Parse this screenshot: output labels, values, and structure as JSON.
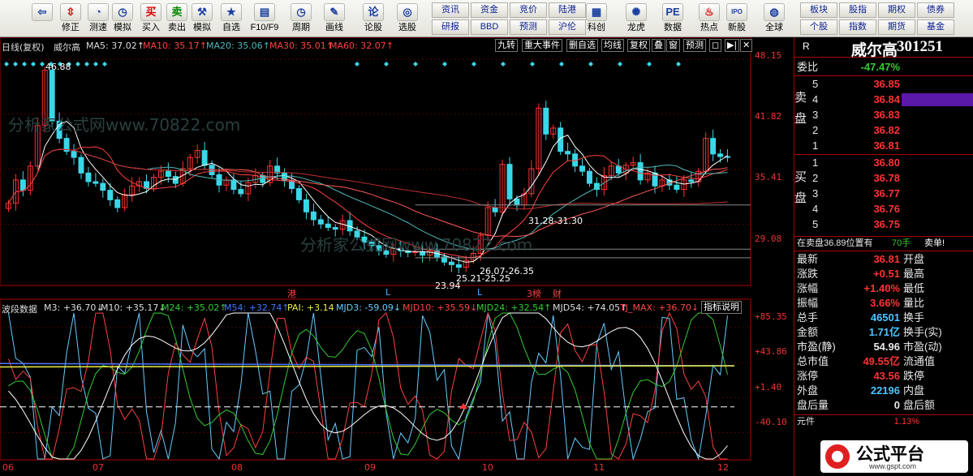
{
  "toolbar": {
    "buttons": [
      {
        "label": "",
        "icon": "back-arrow-icon",
        "glyph": "⇦"
      },
      {
        "label": "修正",
        "icon": "up-down-arrows-icon",
        "glyph": "⇳"
      },
      {
        "label": "测速",
        "icon": "speed-check-icon",
        "glyph": "◔"
      },
      {
        "label": "模拟",
        "icon": "clock-icon",
        "glyph": "◷"
      },
      {
        "label": "买入",
        "icon": "buy-icon",
        "glyph": "买"
      },
      {
        "label": "卖出",
        "icon": "sell-icon",
        "glyph": "卖"
      },
      {
        "label": "模拟",
        "icon": "hammer-icon",
        "glyph": "⚒"
      },
      {
        "label": "自选",
        "icon": "star-icon",
        "glyph": "★"
      },
      {
        "label": "F10/F9",
        "icon": "document-icon",
        "glyph": "▤"
      },
      {
        "label": "周期",
        "icon": "cycle-clock-icon",
        "glyph": "◷"
      },
      {
        "label": "画线",
        "icon": "pen-icon",
        "glyph": "✎"
      },
      {
        "label": "论股",
        "icon": "discussion-icon",
        "glyph": "论"
      },
      {
        "label": "选股",
        "icon": "chart-select-icon",
        "glyph": "◎"
      },
      {
        "label": "科创",
        "icon": "chart-board-icon",
        "glyph": "▦"
      },
      {
        "label": "龙虎",
        "icon": "dragon-icon",
        "glyph": "✺"
      },
      {
        "label": "数据",
        "icon": "pe-icon",
        "glyph": "PE"
      },
      {
        "label": "热点",
        "icon": "hot-fire-icon",
        "glyph": "♨"
      },
      {
        "label": "新股",
        "icon": "ipo-icon",
        "glyph": "IPO"
      },
      {
        "label": "全球",
        "icon": "globe-icon",
        "glyph": "◍"
      }
    ],
    "rect_buttons": [
      "资讯",
      "资金",
      "竞价",
      "陆港",
      "研报",
      "BBD",
      "预测",
      "沪伦",
      "板块",
      "股指",
      "期权",
      "债券",
      "个股",
      "指数",
      "期货",
      "基金"
    ]
  },
  "main": {
    "header": {
      "name": "日线(复权)",
      "stock": "威尔高",
      "ma5": "MA5: 37.02↑",
      "ma10": "MA10: 35.17↑",
      "ma20": "MA20: 35.06↑",
      "ma30": "MA30: 35.01↑",
      "ma60": "MA60: 32.07↑"
    },
    "chart_buttons": [
      "九转",
      "重大事件",
      "删自选",
      "均线",
      "复权",
      "叠",
      "窗",
      "预测",
      "◻",
      "▶|",
      "✕"
    ],
    "price_axis": [
      "48.15",
      "41.82",
      "35.41",
      "29.08"
    ],
    "annotations": {
      "high": "46.88",
      "low": "23.94",
      "range1": "31.28-31.30",
      "range2": "26.07-26.35",
      "range3": "25.21-25.25"
    },
    "markers": [
      "港",
      "L",
      "L",
      "3榜",
      "财"
    ],
    "indicator": {
      "name": "波段数据",
      "m3": "M3: +36.70↓",
      "m10": "M10: +35.17↓",
      "m24": "M24: +35.02↑",
      "m54": "M54: +32.74↑",
      "pai": "PAI: +3.14",
      "mjd3": "MJD3: -59.09↓",
      "mjd10": "MJD10: +35.59↓",
      "mjd24": "MJD24: +32.54↑",
      "mjd54": "MJD54: +74.05↑",
      "tjmax": "TJ_MAX: +36.70↓",
      "help": "指标说明",
      "axis": [
        "+85.35",
        "+43.86",
        "+1.40",
        "-40.10"
      ]
    },
    "date_axis": [
      "06",
      "07",
      "08",
      "09",
      "10",
      "11",
      "12"
    ],
    "watermark": "分析家公式网www.70822.com"
  },
  "side": {
    "r_tab": "R",
    "stock_name": "威尔高",
    "stock_code": "301251",
    "webi_label": "委比",
    "webi_value": "-47.47%",
    "sell_label": "卖盘",
    "buy_label": "买盘",
    "sell": [
      {
        "n": "5",
        "p": "36.85"
      },
      {
        "n": "4",
        "p": "36.84"
      },
      {
        "n": "3",
        "p": "36.83"
      },
      {
        "n": "2",
        "p": "36.82"
      },
      {
        "n": "1",
        "p": "36.81"
      }
    ],
    "buy": [
      {
        "n": "1",
        "p": "36.80"
      },
      {
        "n": "2",
        "p": "36.78"
      },
      {
        "n": "3",
        "p": "36.77"
      },
      {
        "n": "4",
        "p": "36.76"
      },
      {
        "n": "5",
        "p": "36.75"
      }
    ],
    "position_text": "在卖盘36.89位置有",
    "position_qty": "70手",
    "position_tag": "卖单!",
    "stats": [
      {
        "l": "最新",
        "v": "36.81",
        "r": "开盘"
      },
      {
        "l": "涨跌",
        "v": "+0.51",
        "r": "最高"
      },
      {
        "l": "涨幅",
        "v": "+1.40%",
        "r": "最低"
      },
      {
        "l": "振幅",
        "v": "3.66%",
        "r": "量比"
      },
      {
        "l": "总手",
        "v": "46501",
        "r": "换手"
      },
      {
        "l": "金额",
        "v": "1.71亿",
        "r": "换手(实)"
      },
      {
        "l": "市盈(静)",
        "v": "54.96",
        "r": "市盈(动)"
      },
      {
        "l": "总市值",
        "v": "49.55亿",
        "r": "流通值"
      },
      {
        "l": "涨停",
        "v": "43.56",
        "r": "跌停"
      },
      {
        "l": "外盘",
        "v": "22196",
        "r": "内盘"
      },
      {
        "l": "盘后量",
        "v": "0",
        "r": "盘后额"
      }
    ],
    "yuan_label": "元件",
    "yuan_value": "1.13%",
    "logo_text": "公式平台",
    "logo_url": "www.gspt.com"
  },
  "chart_data": {
    "type": "candlestick",
    "title": "日线(复权) 威尔高",
    "xlabel": "",
    "ylabel": "",
    "ylim": [
      22,
      49
    ],
    "x": [
      "06",
      "07",
      "08",
      "09",
      "10",
      "11",
      "12"
    ],
    "close": [
      31.5,
      34.2,
      33.0,
      35.8,
      40.5,
      46.88,
      41.0,
      39.0,
      37.5,
      36.8,
      35.0,
      34.0,
      33.8,
      33.0,
      31.9,
      31.0,
      32.5,
      33.5,
      34.0,
      33.2,
      34.5,
      35.2,
      34.6,
      33.8,
      35.5,
      36.8,
      37.6,
      35.9,
      34.8,
      33.6,
      34.2,
      33.1,
      32.6,
      33.9,
      34.7,
      33.9,
      35.8,
      35.0,
      34.1,
      33.2,
      31.9,
      30.5,
      29.6,
      29.1,
      28.7,
      28.5,
      29.5,
      28.3,
      27.6,
      27.0,
      26.6,
      26.0,
      25.6,
      26.3,
      26.0,
      25.8,
      25.9,
      25.5,
      26.0,
      25.3,
      24.7,
      24.4,
      24.1,
      24.9,
      25.7,
      27.8,
      31.0,
      30.5,
      36.0,
      32.0,
      31.3,
      32.6,
      35.5,
      42.5,
      39.5,
      40.2,
      37.5,
      37.2,
      35.8,
      35.2,
      33.8,
      33.1,
      34.7,
      35.8,
      35.0,
      35.9,
      36.2,
      34.2,
      35.0,
      33.5,
      34.2,
      33.6,
      33.1,
      34.2,
      34.0,
      35.2,
      39.0,
      37.2,
      36.9,
      36.81
    ],
    "ma_labels": [
      "MA5: 37.02",
      "MA10: 35.17",
      "MA20: 35.06",
      "MA30: 35.01",
      "MA60: 32.07"
    ]
  }
}
